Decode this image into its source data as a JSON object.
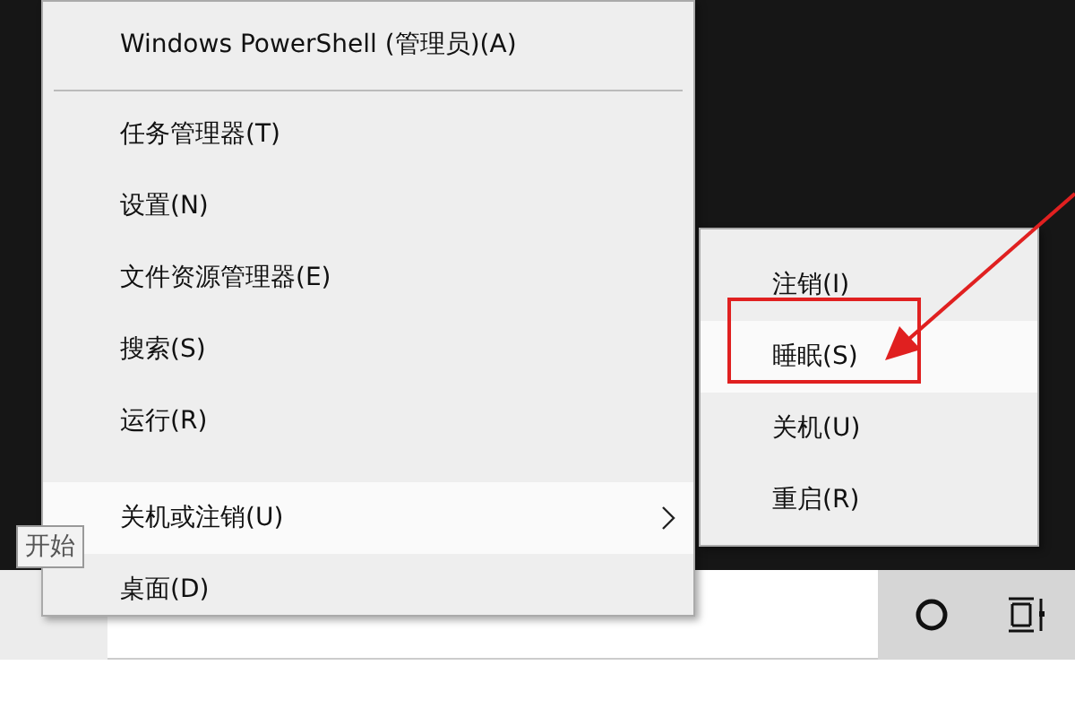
{
  "context_menu": {
    "items": [
      {
        "kind": "item",
        "label": "Windows PowerShell (管理员)(A)",
        "selected": false
      },
      {
        "kind": "separator",
        "line": true
      },
      {
        "kind": "item",
        "label": "任务管理器(T)",
        "selected": false
      },
      {
        "kind": "item",
        "label": "设置(N)",
        "selected": false
      },
      {
        "kind": "item",
        "label": "文件资源管理器(E)",
        "selected": false
      },
      {
        "kind": "item",
        "label": "搜索(S)",
        "selected": false
      },
      {
        "kind": "item",
        "label": "运行(R)",
        "selected": false
      },
      {
        "kind": "separator",
        "line": false
      },
      {
        "kind": "item",
        "label": "关机或注销(U)",
        "selected": true,
        "submenu": true
      },
      {
        "kind": "item",
        "label": "桌面(D)",
        "selected": false
      }
    ]
  },
  "submenu": {
    "items": [
      {
        "label": "注销(I)",
        "selected": false
      },
      {
        "label": "睡眠(S)",
        "selected": true,
        "annotated": true
      },
      {
        "label": "关机(U)",
        "selected": false
      },
      {
        "label": "重启(R)",
        "selected": false
      }
    ]
  },
  "tooltip": "开始"
}
